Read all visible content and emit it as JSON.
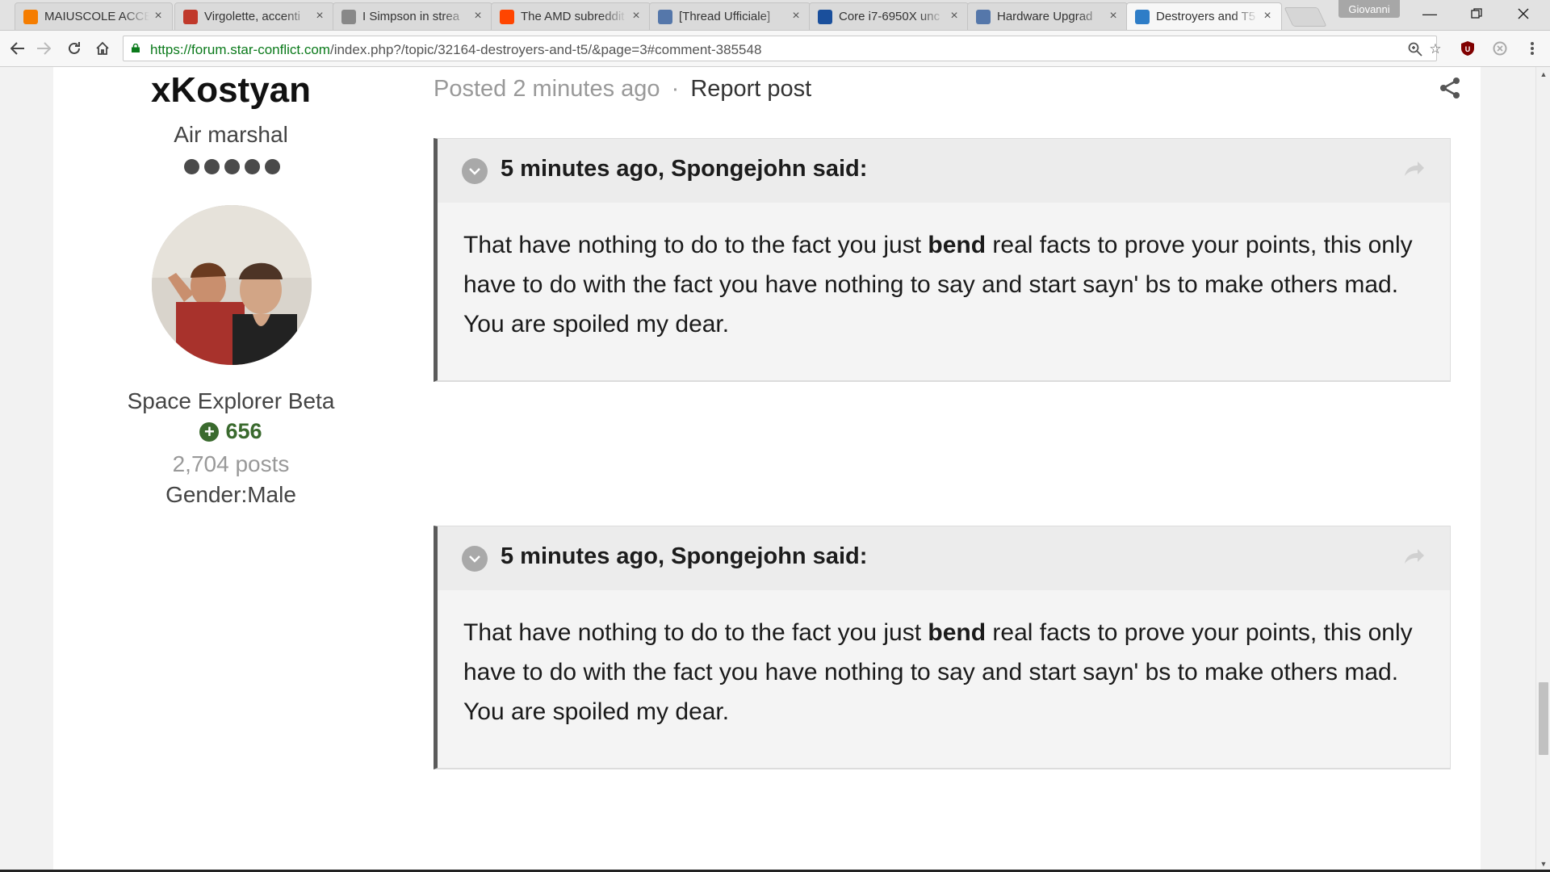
{
  "browser": {
    "tabs": [
      {
        "title": "MAIUSCOLE ACCE",
        "favicon": "blogger-icon",
        "color": "#f57d00",
        "active": false
      },
      {
        "title": "Virgolette, accenti",
        "favicon": "quote-mark-icon",
        "color": "#c0392b",
        "active": false
      },
      {
        "title": "I Simpson in strea",
        "favicon": "page-icon",
        "color": "#888888",
        "active": false
      },
      {
        "title": "The AMD subreddit",
        "favicon": "reddit-icon",
        "color": "#ff4500",
        "active": false
      },
      {
        "title": "[Thread Ufficiale]",
        "favicon": "forum-icon",
        "color": "#5577aa",
        "active": false
      },
      {
        "title": "Core i7-6950X unc",
        "favicon": "pcgh-icon",
        "color": "#1a4f9c",
        "active": false
      },
      {
        "title": "Hardware Upgrad",
        "favicon": "forum-icon",
        "color": "#5577aa",
        "active": false
      },
      {
        "title": "Destroyers and T5",
        "favicon": "star-conflict-icon",
        "color": "#2e7dc7",
        "active": true
      }
    ],
    "profile_name": "Giovanni",
    "url": {
      "scheme": "https://",
      "host": "forum.star-conflict.com",
      "path": "/index.php?/topic/32164-destroyers-and-t5/&page=3#comment-385548"
    }
  },
  "author": {
    "name": "xKostyan",
    "title": "Air marshal",
    "rank_pips": 5,
    "group": "Space Explorer Beta",
    "reputation": "656",
    "post_count": "2,704 posts",
    "gender_label": "Gender:",
    "gender_value": "Male"
  },
  "post": {
    "posted": "Posted 2 minutes ago",
    "separator": "·",
    "report_label": "Report post"
  },
  "quotes": [
    {
      "citation": "5 minutes ago, Spongejohn said:",
      "text_before": "That have nothing to do to the fact you just ",
      "text_bold": "bend",
      "text_after": " real facts to prove your points, this only have to do with the fact you have nothing to say and start sayn' bs to make others mad. You are spoiled my dear."
    },
    {
      "citation": "5 minutes ago, Spongejohn said:",
      "text_before": "That have nothing to do to the fact you just ",
      "text_bold": "bend",
      "text_after": " real facts to prove your points, this only have to do with the fact you have nothing to say and start sayn' bs to make others mad. You are spoiled my dear."
    }
  ],
  "colors": {
    "reputation_green": "#3a6a2e",
    "quote_border": "#5a5a5a",
    "url_host": "#0b7a1b"
  }
}
